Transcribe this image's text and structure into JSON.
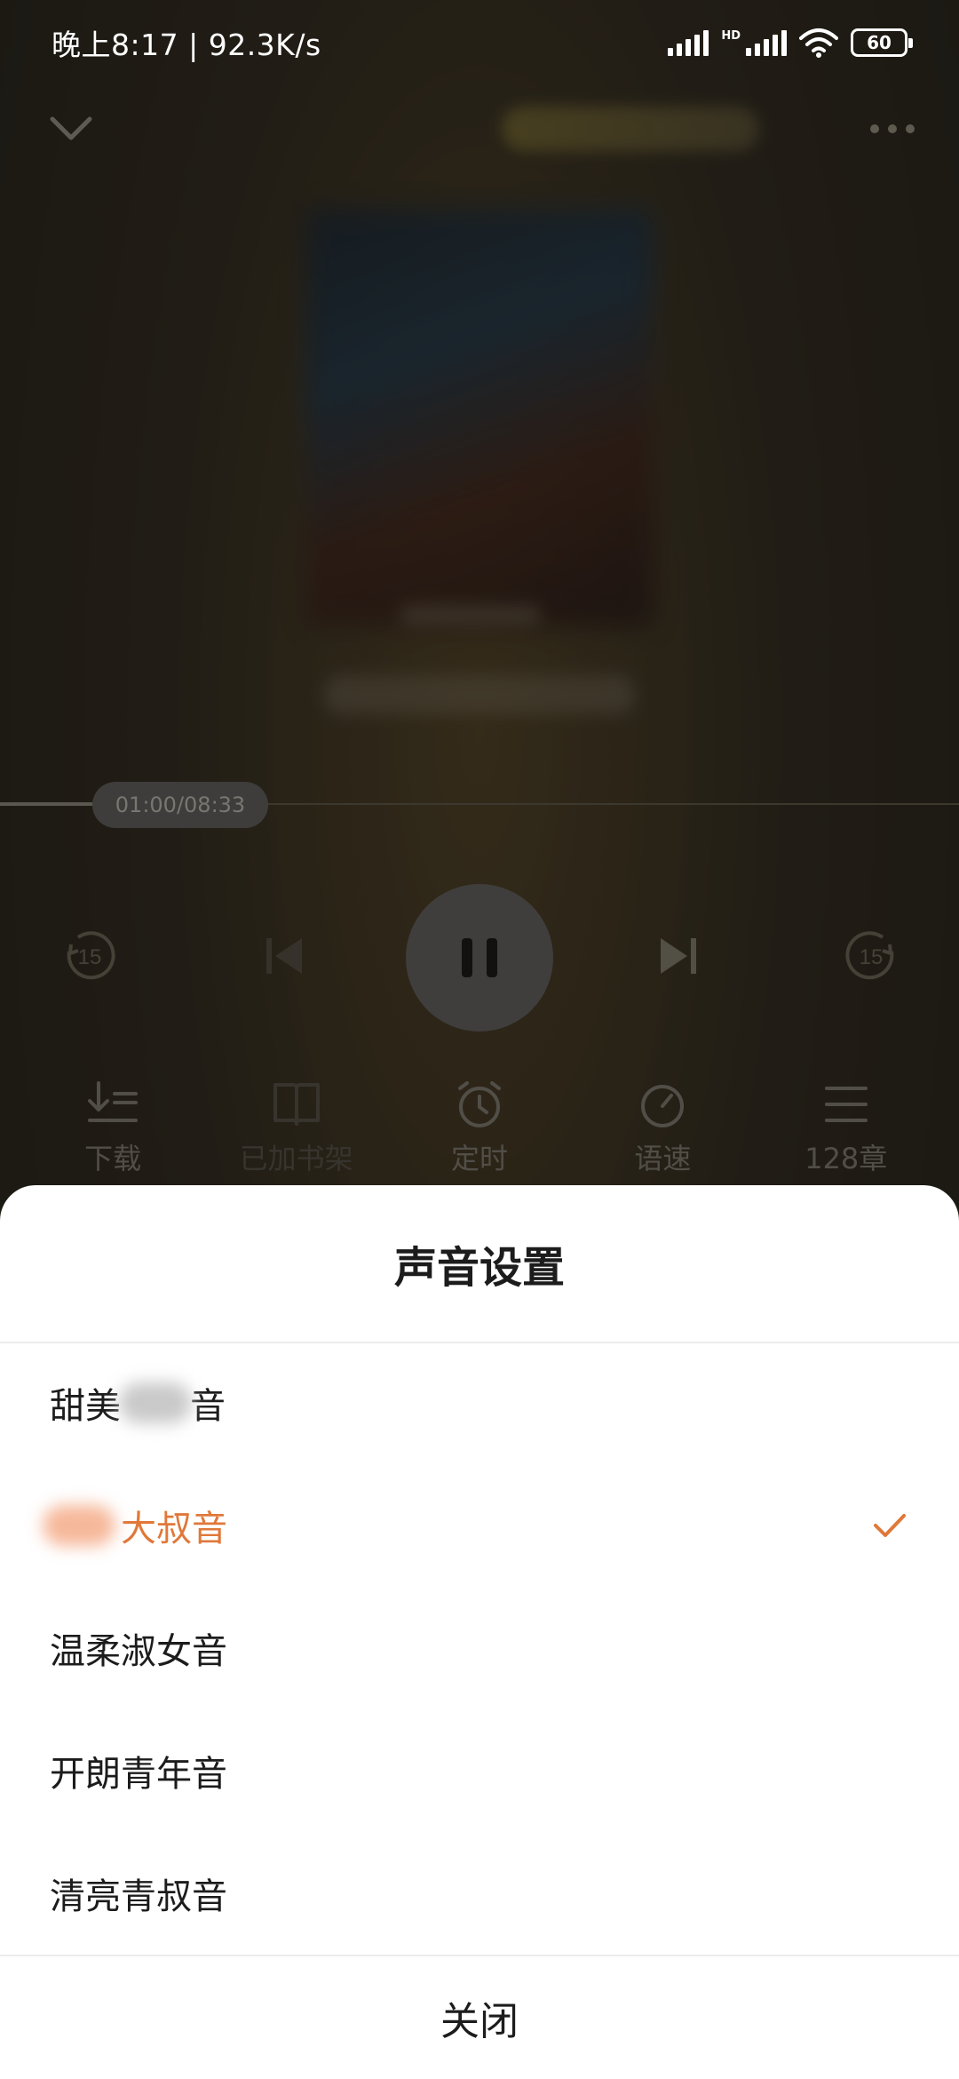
{
  "status_bar": {
    "time_speed": "晚上8:17 | 92.3K/s",
    "network_badge": "HD",
    "battery": "60"
  },
  "player": {
    "time_display": "01:00/08:33",
    "progress": 0.117,
    "skip_back_seconds": "15",
    "skip_forward_seconds": "15"
  },
  "toolbar": [
    {
      "label": "下载",
      "icon": "download-icon"
    },
    {
      "label": "已加书架",
      "icon": "bookshelf-icon"
    },
    {
      "label": "定时",
      "icon": "alarm-clock-icon"
    },
    {
      "label": "语速",
      "icon": "speed-icon"
    },
    {
      "label": "128章",
      "icon": "chapter-list-icon"
    }
  ],
  "sheet": {
    "title": "声音设置",
    "options": [
      {
        "prefix": "甜美",
        "suffix": "音",
        "selected": false
      },
      {
        "prefix": "",
        "suffix": "大叔音",
        "selected": true
      },
      {
        "prefix": "",
        "suffix": "温柔淑女音",
        "selected": false
      },
      {
        "prefix": "",
        "suffix": "开朗青年音",
        "selected": false
      },
      {
        "prefix": "",
        "suffix": "清亮青叔音",
        "selected": false
      }
    ],
    "close_label": "关闭"
  },
  "colors": {
    "accent": "#e0783a",
    "sheet_bg": "#ffffff",
    "overlay_bg": "#2f2b22"
  }
}
